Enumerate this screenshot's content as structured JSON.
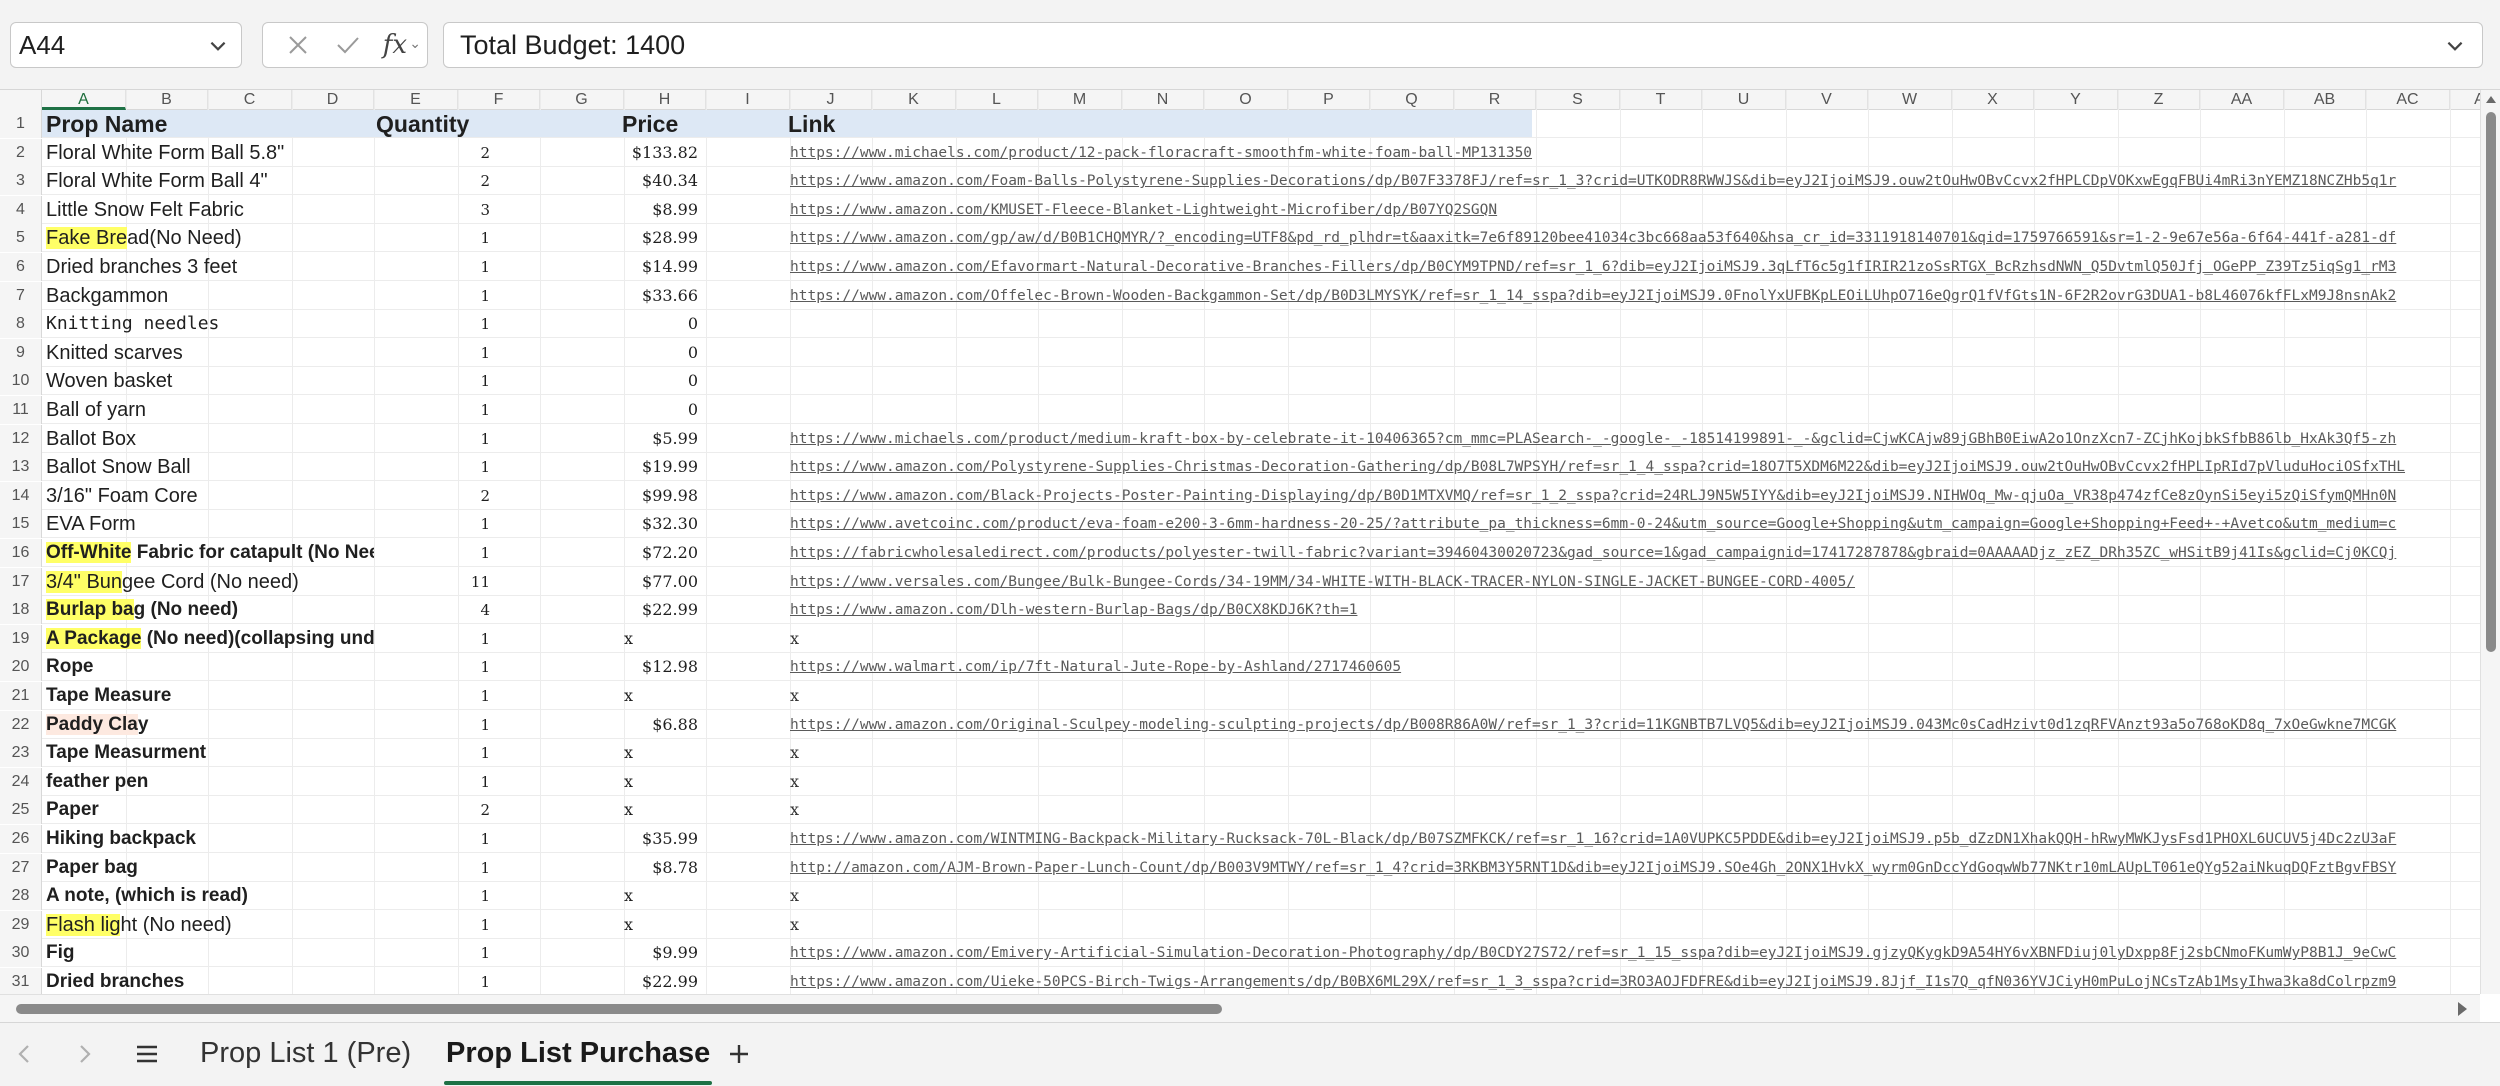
{
  "formula_bar": {
    "cell_ref": "A44",
    "fx_label": "fx",
    "content": "Total Budget: 1400"
  },
  "columns": [
    "A",
    "B",
    "C",
    "D",
    "E",
    "F",
    "G",
    "H",
    "I",
    "J",
    "K",
    "L",
    "M",
    "N",
    "O",
    "P",
    "Q",
    "R",
    "S",
    "T",
    "U",
    "V",
    "W",
    "X",
    "Y",
    "Z",
    "AA",
    "AB",
    "AC",
    "A"
  ],
  "header": {
    "row": "1",
    "name": "Prop Name",
    "qty": "Quantity",
    "price": "Price",
    "link": "Link"
  },
  "rows": [
    {
      "n": "2",
      "name": "Floral White Form Ball 5.8\"",
      "qty": "2",
      "price": "$133.82",
      "link": "https://www.michaels.com/product/12-pack-floracraft-smoothfm-white-foam-ball-MP131350"
    },
    {
      "n": "3",
      "name": "Floral White Form Ball 4\"",
      "qty": "2",
      "price": "$40.34",
      "link": "https://www.amazon.com/Foam-Balls-Polystyrene-Supplies-Decorations/dp/B07F3378FJ/ref=sr_1_3?crid=UTKODR8RWWJS&dib=eyJ2IjoiMSJ9.ouw2tOuHwOBvCcvx2fHPLCDpVOKxwEgqFBUi4mRi3nYEMZ18NCZHb5q1r"
    },
    {
      "n": "4",
      "name": "Little Snow Felt Fabric",
      "qty": "3",
      "price": "$8.99",
      "link": "https://www.amazon.com/KMUSET-Fleece-Blanket-Lightweight-Microfiber/dp/B07YQ2SGQN"
    },
    {
      "n": "5",
      "name_hl": "Fake Bre",
      "name": "ad(No Need)",
      "qty": "1",
      "price": "$28.99",
      "link": "https://www.amazon.com/gp/aw/d/B0B1CHQMYR/?_encoding=UTF8&pd_rd_plhdr=t&aaxitk=7e6f89120bee41034c3bc668aa53f640&hsa_cr_id=3311918140701&qid=1759766591&sr=1-2-9e67e56a-6f64-441f-a281-df"
    },
    {
      "n": "6",
      "name": "Dried branches 3 feet",
      "qty": "1",
      "price": "$14.99",
      "link": "https://www.amazon.com/Efavormart-Natural-Decorative-Branches-Fillers/dp/B0CYM9TPND/ref=sr_1_6?dib=eyJ2IjoiMSJ9.3qLfT6c5g1fIRIR21zoSsRTGX_BcRzhsdNWN_Q5DvtmlQ50Jfj_OGePP_Z39Tz5iqSg1_rM3"
    },
    {
      "n": "7",
      "name": "Backgammon",
      "qty": "1",
      "price": "$33.66",
      "link": "https://www.amazon.com/Offelec-Brown-Wooden-Backgammon-Set/dp/B0D3LMYSYK/ref=sr_1_14_sspa?dib=eyJ2IjoiMSJ9.0FnolYxUFBKpLEOiLUhpO716eQgrQ1fVfGts1N-6F2R2ovrG3DUA1-b8L46076kfFLxM9J8nsnAk2"
    },
    {
      "n": "8",
      "name": "Knitting needles",
      "mono": true,
      "qty": "1",
      "price": "0",
      "link": ""
    },
    {
      "n": "9",
      "name": "Knitted scarves",
      "qty": "1",
      "price": "0",
      "link": ""
    },
    {
      "n": "10",
      "name": "Woven basket",
      "qty": "1",
      "price": "0",
      "link": ""
    },
    {
      "n": "11",
      "name": "Ball of yarn",
      "qty": "1",
      "price": "0",
      "link": ""
    },
    {
      "n": "12",
      "name": "Ballot Box",
      "qty": "1",
      "price": "$5.99",
      "link": "https://www.michaels.com/product/medium-kraft-box-by-celebrate-it-10406365?cm_mmc=PLASearch-_-google-_-18514199891-_-&gclid=CjwKCAjw89jGBhB0EiwA2o1OnzXcn7-ZCjhKojbkSfbB86lb_HxAk3Qf5-zh"
    },
    {
      "n": "13",
      "name": "Ballot Snow Ball",
      "qty": "1",
      "price": "$19.99",
      "link": "https://www.amazon.com/Polystyrene-Supplies-Christmas-Decoration-Gathering/dp/B08L7WPSYH/ref=sr_1_4_sspa?crid=18O7T5XDM6M22&dib=eyJ2IjoiMSJ9.ouw2tOuHwOBvCcvx2fHPLIpRId7pVluduHociOSfxTHL"
    },
    {
      "n": "14",
      "name": "3/16\" Foam Core",
      "qty": "2",
      "price": "$99.98",
      "link": "https://www.amazon.com/Black-Projects-Poster-Painting-Displaying/dp/B0D1MTXVMQ/ref=sr_1_2_sspa?crid=24RLJ9N5W5IYY&dib=eyJ2IjoiMSJ9.NIHWOq_Mw-qjuOa_VR38p474zfCe8zOynSi5eyi5zQiSfymQMHn0N"
    },
    {
      "n": "15",
      "name": "EVA Form",
      "qty": "1",
      "price": "$32.30",
      "link": "https://www.avetcoinc.com/product/eva-foam-e200-3-6mm-hardness-20-25/?attribute_pa_thickness=6mm-0-24&utm_source=Google+Shopping&utm_campaign=Google+Shopping+Feed+-+Avetco&utm_medium=c"
    },
    {
      "n": "16",
      "bold": true,
      "name_hl": "Off-White",
      "name": " Fabric for catapult (No Need",
      "qty": "1",
      "price": "$72.20",
      "link": "https://fabricwholesaledirect.com/products/polyester-twill-fabric?variant=39460430020723&gad_source=1&gad_campaignid=17417287878&gbraid=0AAAAADjz_zEZ_DRh35ZC_wHSitB9j41Is&gclid=Cj0KCQj"
    },
    {
      "n": "17",
      "name_hl": "3/4\" Bun",
      "name": "gee Cord (No need)",
      "qty": "11",
      "price": "$77.00",
      "link": "https://www.versales.com/Bungee/Bulk-Bungee-Cords/34-19MM/34-WHITE-WITH-BLACK-TRACER-NYLON-SINGLE-JACKET-BUNGEE-CORD-4005/"
    },
    {
      "n": "18",
      "bold": true,
      "name_hl": "Burlap ba",
      "name": "g (No need)",
      "qty": "4",
      "price": "$22.99",
      "link": "https://www.amazon.com/Dlh-western-Burlap-Bags/dp/B0CX8KDJ6K?th=1"
    },
    {
      "n": "19",
      "bold": true,
      "name_hl": "A Package",
      "name": " (No need)(collapsing under",
      "qty": "1",
      "price": "x",
      "link": "x"
    },
    {
      "n": "20",
      "bold": true,
      "name": "Rope",
      "qty": "1",
      "price": "$12.98",
      "link": "https://www.walmart.com/ip/7ft-Natural-Jute-Rope-by-Ashland/2717460605"
    },
    {
      "n": "21",
      "bold": true,
      "name": "Tape Measure",
      "qty": "1",
      "price": "x",
      "link": "x"
    },
    {
      "n": "22",
      "bold": true,
      "name_pk": "Paddy Cla",
      "name": "y",
      "qty": "1",
      "price": "$6.88",
      "link": "https://www.amazon.com/Original-Sculpey-modeling-sculpting-projects/dp/B008R86A0W/ref=sr_1_3?crid=11KGNBTB7LVQ5&dib=eyJ2IjoiMSJ9.043Mc0sCadHzivt0d1zqRFVAnzt93a5o768oKD8q_7xOeGwkne7MCGK"
    },
    {
      "n": "23",
      "bold": true,
      "name": "Tape Measurment",
      "qty": "1",
      "price": "x",
      "link": "x"
    },
    {
      "n": "24",
      "bold": true,
      "name": "feather pen",
      "qty": "1",
      "price": "x",
      "link": "x"
    },
    {
      "n": "25",
      "bold": true,
      "name": "Paper",
      "qty": "2",
      "price": "x",
      "link": "x"
    },
    {
      "n": "26",
      "bold": true,
      "name": "Hiking backpack",
      "qty": "1",
      "price": "$35.99",
      "link": "https://www.amazon.com/WINTMING-Backpack-Military-Rucksack-70L-Black/dp/B07SZMFKCK/ref=sr_1_16?crid=1A0VUPKC5PDDE&dib=eyJ2IjoiMSJ9.p5b_dZzDN1XhakQQH-hRwyMWKJysFsd1PHOXL6UCUV5j4Dc2zU3aF"
    },
    {
      "n": "27",
      "bold": true,
      "name": "Paper bag",
      "qty": "1",
      "price": "$8.78",
      "link": "http://amazon.com/AJM-Brown-Paper-Lunch-Count/dp/B003V9MTWY/ref=sr_1_4?crid=3RKBM3Y5RNT1D&dib=eyJ2IjoiMSJ9.SOe4Gh_2ONX1HvkX_wyrm0GnDccYdGoqwWb77NKtr10mLAUpLT061eQYg52aiNkuqDQFztBgvFBSY"
    },
    {
      "n": "28",
      "bold": true,
      "name": "A note, (which is read)",
      "qty": "1",
      "price": "x",
      "link": "x"
    },
    {
      "n": "29",
      "name_hl": "Flash lig",
      "name": "ht (No need)",
      "qty": "1",
      "price": "x",
      "link": "x"
    },
    {
      "n": "30",
      "bold": true,
      "name": "Fig",
      "qty": "1",
      "price": "$9.99",
      "link": "https://www.amazon.com/Emivery-Artificial-Simulation-Decoration-Photography/dp/B0CDY27S72/ref=sr_1_15_sspa?dib=eyJ2IjoiMSJ9.gjzyQKygkD9A54HY6vXBNFDiuj0lyDxpp8Fj2sbCNmoFKumWyP8B1J_9eCwC"
    },
    {
      "n": "31",
      "bold": true,
      "name": "Dried branches",
      "qty": "1",
      "price": "$22.99",
      "link": "https://www.amazon.com/Uieke-50PCS-Birch-Twigs-Arrangements/dp/B0BX6ML29X/ref=sr_1_3_sspa?crid=3RO3AOJFDFRE&dib=eyJ2IjoiMSJ9.8Jjf_I1s7Q_qfN036YVJCiyH0mPuLojNCsTzAb1MsyIhwa3ka8dColrpzm9"
    }
  ],
  "sheet_tabs": {
    "tab1": "Prop List 1 (Pre)",
    "tab2": "Prop List Purchase",
    "active": "Prop List Purchase"
  },
  "colors": {
    "highlight": "#ffff66",
    "accent": "#1e7145",
    "header_fill": "#dde8f5"
  }
}
